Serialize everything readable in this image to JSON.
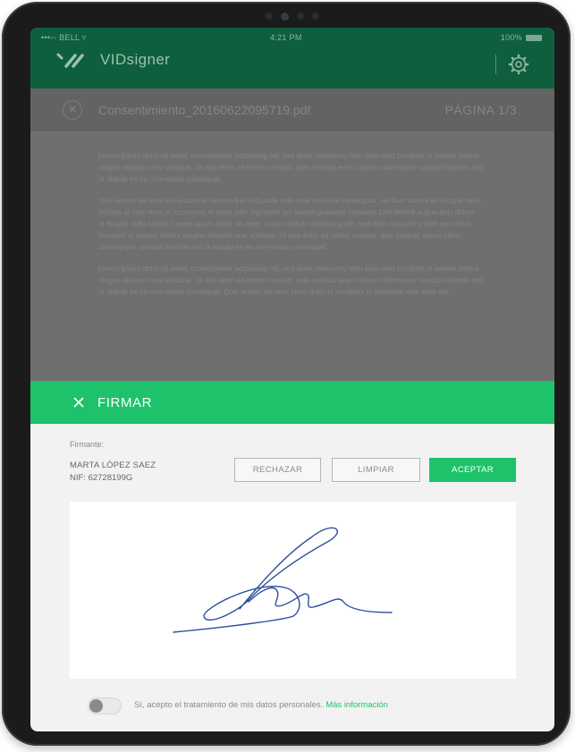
{
  "status_bar": {
    "carrier": "•••◦◦ BELL ▿",
    "time": "4:21 PM",
    "battery": "100%"
  },
  "header": {
    "app_name": "VIDsigner",
    "logo_icon": "vidsigner-logo-icon",
    "settings_icon": "gear-icon"
  },
  "document": {
    "filename": "Consentimiento_20160622095719.pdf",
    "page": "PÁGINA 1/3",
    "paragraphs": [
      "Lorem ipsum dolor sit amet, consectetuer adipiscing elit, sed diam nonummy nibh euis-mod tincidunt ut laoreet dolore magna aliquam erat volutpat. Ut wisi enim ad minim veniam, quis nostrud exerci tation ullamcorper suscipit lobortis nisl ut aliquip ex ea com-modo consequat.",
      "Duis autem vel eum iriure dolor in hendrerit in vulputate velit esse molestie consequat, vel illum dolore eu feugiat nulla facilisis at vero eros et accumsan et iusto odio dignissim qui blandit praesent luptatum zzril delenit augue duis dolore te feugait nulla facilisi. Lorem ipsum dolor sit amet, cons ectetuer adipiscing elit, sed diam nonummy nibh euis-mod tincidunt ut laoreet dolore magna aliquam erat volutpat. Ut wisi enim ad minim veniam, quis nostrud exerci tation ullamcorper suscipit lobortis nisl ut aliquip ex ea com-modo consequat.",
      "Lorem ipsum dolor sit amet, consectetuer adipiscing elit, sed diam nonummy nibh euis-mod tincidunt ut laoreet dolore magna aliquam erat volutpat. Ut wisi enim ad minim veniam, quis nostrud exerci tation ullamcorper suscipit lobortis nisl ut aliquip ex ea com-modo consequat. Duis autem vel eum iriure dolor in hendrerit in vulputate velit esse mo-"
    ]
  },
  "sign_panel": {
    "title": "FIRMAR",
    "signer_label": "Firmante:",
    "signer_name": "MARTA LÓPEZ SAEZ",
    "signer_nif": "NIF: 62728199G",
    "reject_label": "RECHAZAR",
    "clear_label": "LIMPIAR",
    "accept_label": "ACEPTAR"
  },
  "consent": {
    "text": "Sí, acepto el tratamiento de mis datos personales.",
    "link": "Más información",
    "toggle_on": false
  },
  "colors": {
    "header_bg": "#0e5f3e",
    "accent": "#1ec26b",
    "signature_ink": "#2f4f9a"
  }
}
